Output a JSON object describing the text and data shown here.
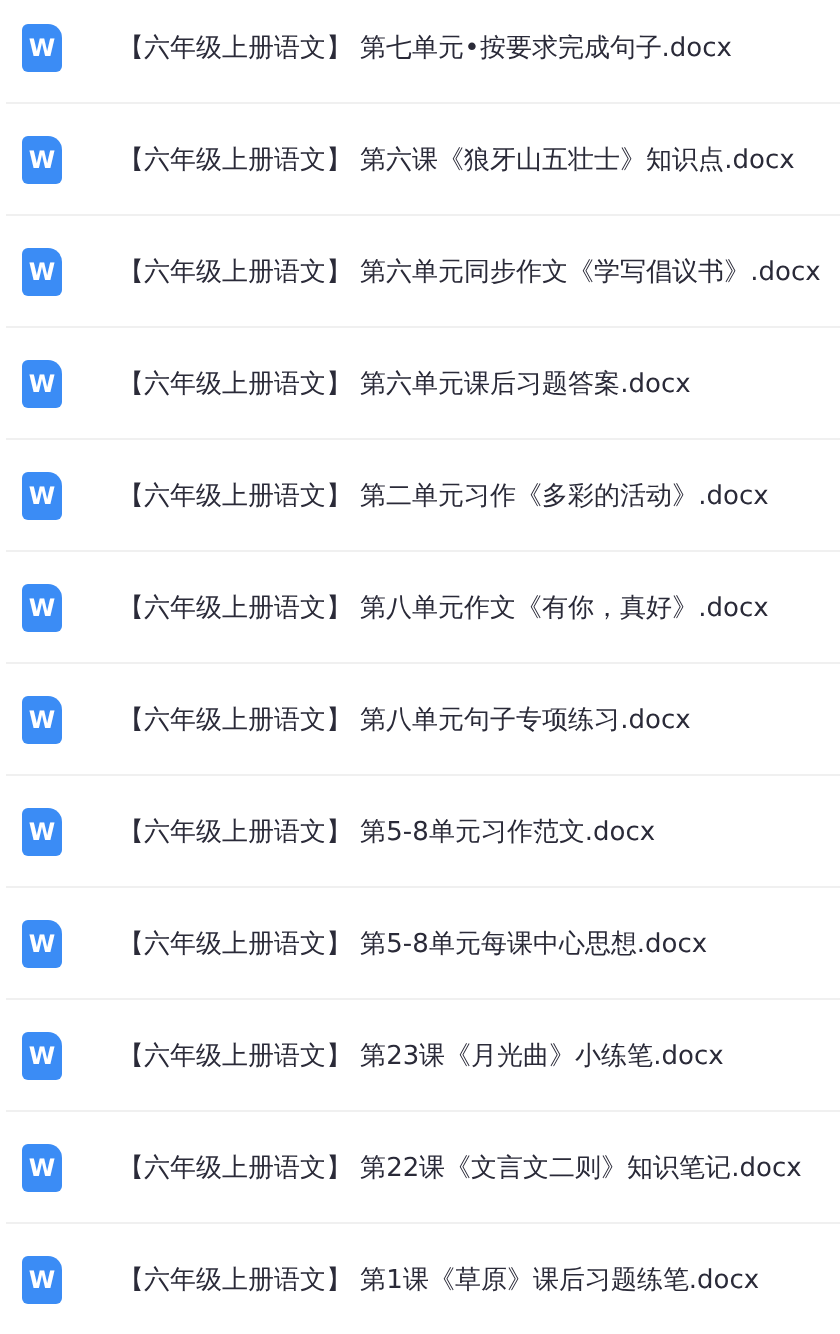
{
  "files": [
    {
      "icon_letter": "W",
      "name": "【六年级上册语文】 第七单元•按要求完成句子.docx"
    },
    {
      "icon_letter": "W",
      "name": "【六年级上册语文】 第六课《狼牙山五壮士》知识点.docx"
    },
    {
      "icon_letter": "W",
      "name": "【六年级上册语文】 第六单元同步作文《学写倡议书》.docx"
    },
    {
      "icon_letter": "W",
      "name": "【六年级上册语文】 第六单元课后习题答案.docx"
    },
    {
      "icon_letter": "W",
      "name": "【六年级上册语文】 第二单元习作《多彩的活动》.docx"
    },
    {
      "icon_letter": "W",
      "name": "【六年级上册语文】 第八单元作文《有你，真好》.docx"
    },
    {
      "icon_letter": "W",
      "name": "【六年级上册语文】 第八单元句子专项练习.docx"
    },
    {
      "icon_letter": "W",
      "name": "【六年级上册语文】 第5-8单元习作范文.docx"
    },
    {
      "icon_letter": "W",
      "name": "【六年级上册语文】 第5-8单元每课中心思想.docx"
    },
    {
      "icon_letter": "W",
      "name": "【六年级上册语文】 第23课《月光曲》小练笔.docx"
    },
    {
      "icon_letter": "W",
      "name": "【六年级上册语文】 第22课《文言文二则》知识笔记.docx"
    },
    {
      "icon_letter": "W",
      "name": "【六年级上册语文】 第1课《草原》课后习题练笔.docx"
    }
  ]
}
